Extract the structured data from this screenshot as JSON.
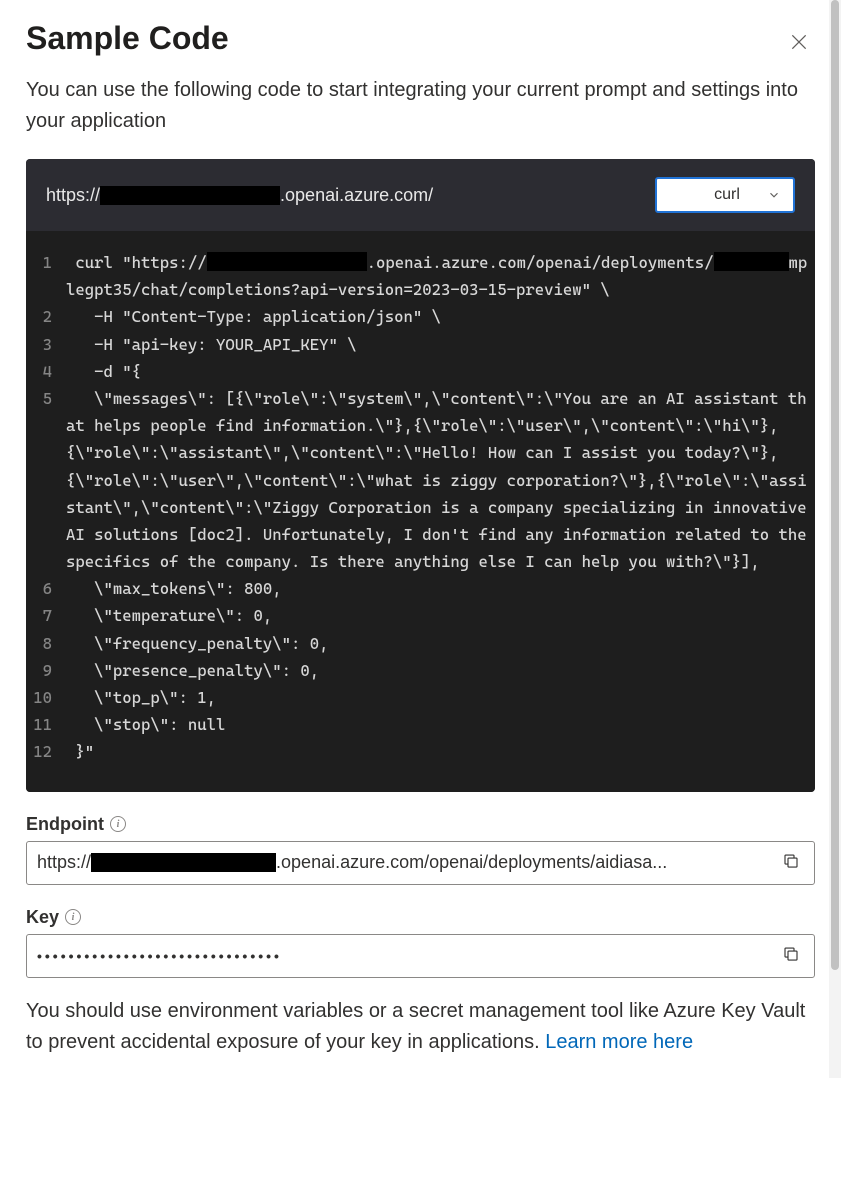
{
  "header": {
    "title": "Sample Code",
    "subtitle": "You can use the following code to start integrating your current prompt and settings into your application"
  },
  "code_header": {
    "url_prefix": "https://",
    "url_suffix": ".openai.azure.com/",
    "language": "curl"
  },
  "code_lines": [
    {
      "n": 1,
      "before": " curl \"https://",
      "redact": "w2",
      "after": ".openai.azure.com/openai/deployments/",
      "redact2": "w3",
      "after2": "mplegpt35/chat/completions?api-version=2023-03-15-preview\" \\"
    },
    {
      "n": 2,
      "text": "   -H \"Content-Type: application/json\" \\"
    },
    {
      "n": 3,
      "text": "   -H \"api-key: YOUR_API_KEY\" \\"
    },
    {
      "n": 4,
      "text": "   -d \"{"
    },
    {
      "n": 5,
      "text": "   \\\"messages\\\": [{\\\"role\\\":\\\"system\\\",\\\"content\\\":\\\"You are an AI assistant that helps people find information.\\\"},{\\\"role\\\":\\\"user\\\",\\\"content\\\":\\\"hi\\\"},{\\\"role\\\":\\\"assistant\\\",\\\"content\\\":\\\"Hello! How can I assist you today?\\\"},{\\\"role\\\":\\\"user\\\",\\\"content\\\":\\\"what is ziggy corporation?\\\"},{\\\"role\\\":\\\"assistant\\\",\\\"content\\\":\\\"Ziggy Corporation is a company specializing in innovative AI solutions [doc2]. Unfortunately, I don't find any information related to the specifics of the company. Is there anything else I can help you with?\\\"}],"
    },
    {
      "n": 6,
      "text": "   \\\"max_tokens\\\": 800,"
    },
    {
      "n": 7,
      "text": "   \\\"temperature\\\": 0,"
    },
    {
      "n": 8,
      "text": "   \\\"frequency_penalty\\\": 0,"
    },
    {
      "n": 9,
      "text": "   \\\"presence_penalty\\\": 0,"
    },
    {
      "n": 10,
      "text": "   \\\"top_p\\\": 1,"
    },
    {
      "n": 11,
      "text": "   \\\"stop\\\": null"
    },
    {
      "n": 12,
      "text": " }\""
    }
  ],
  "endpoint": {
    "label": "Endpoint",
    "prefix": "https://",
    "suffix": ".openai.azure.com/openai/deployments/aidiasa..."
  },
  "key": {
    "label": "Key",
    "masked": "•••••••••••••••••••••••••••••••"
  },
  "warning": {
    "text": "You should use environment variables or a secret management tool like Azure Key Vault to prevent accidental exposure of your key in applications. ",
    "link_text": "Learn more here"
  }
}
